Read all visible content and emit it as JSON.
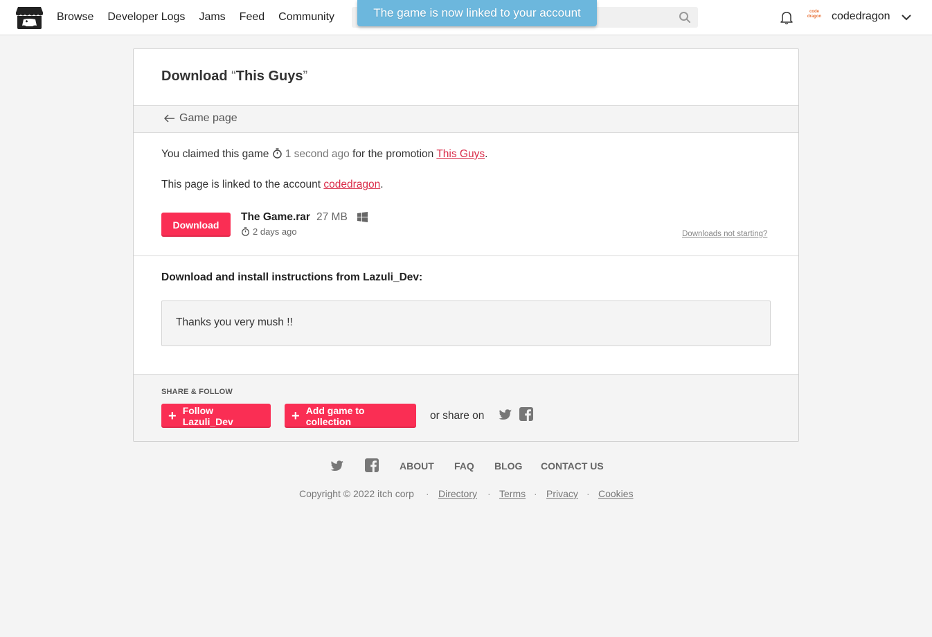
{
  "header": {
    "nav": [
      "Browse",
      "Developer Logs",
      "Jams",
      "Feed",
      "Community"
    ],
    "toast": "The game is now linked to your account",
    "username": "codedragon",
    "avatar_text": "code dragon"
  },
  "card": {
    "title_prefix": "Download ",
    "title_open_quote": "“",
    "title_name": "This Guys",
    "title_close_quote": "”",
    "back_link": "Game page",
    "claim_prefix": "You claimed this game",
    "claim_time": "1 second ago",
    "claim_middle": "for the promotion",
    "claim_promo": "This Guys",
    "claim_suffix": ".",
    "account_prefix": "This page is linked to the account",
    "account_name": "codedragon",
    "account_suffix": ".",
    "download_label": "Download",
    "file_name": "The Game.rar",
    "file_size": "27 MB",
    "file_date": "2 days ago",
    "not_starting": "Downloads not starting?",
    "instructions_title": "Download and install instructions from Lazuli_Dev:",
    "instructions_text": "Thanks you very mush !!",
    "share_label": "SHARE & FOLLOW",
    "follow_label": "Follow Lazuli_Dev",
    "collection_label": "Add game to collection",
    "share_on": "or share on"
  },
  "footer": {
    "links": [
      "ABOUT",
      "FAQ",
      "BLOG",
      "CONTACT US"
    ],
    "copyright": "Copyright © 2022 itch corp",
    "legal": [
      "Directory",
      "Terms",
      "Privacy",
      "Cookies"
    ]
  },
  "colors": {
    "accent": "#fa2e54",
    "link": "#da2c49",
    "toast": "#6cb7dd"
  }
}
